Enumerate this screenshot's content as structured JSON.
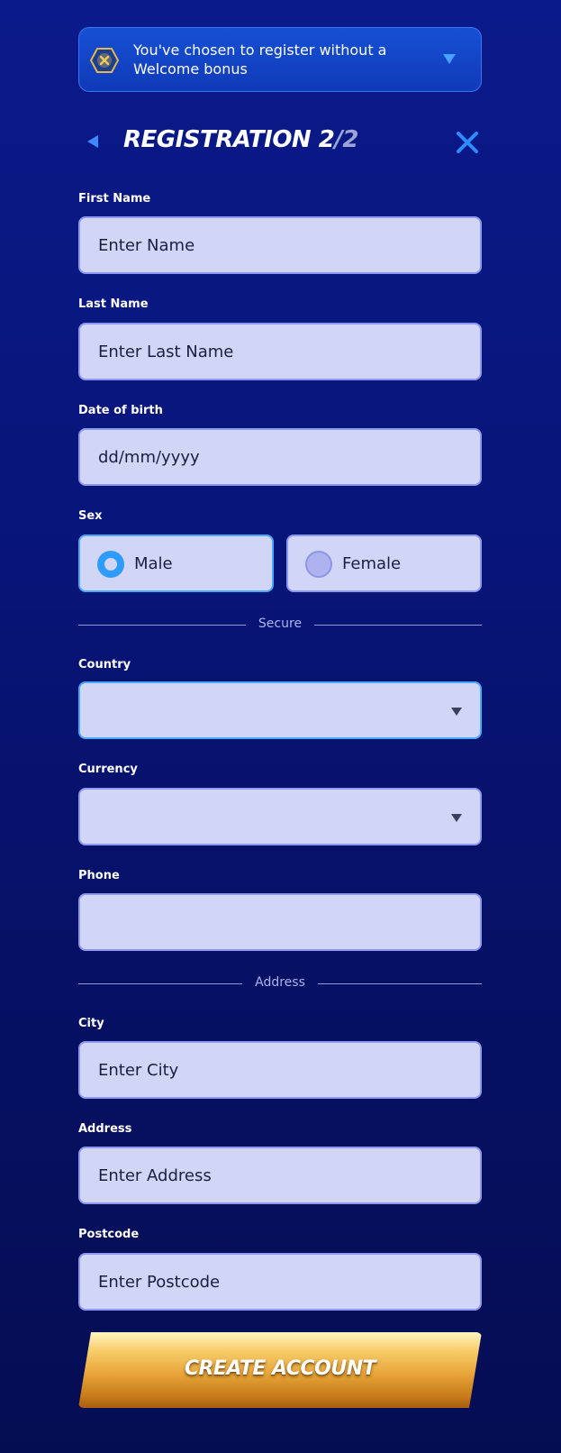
{
  "banner": {
    "text": "You've chosen to register without a Welcome bonus",
    "icon": "bonus-hexagon-icon"
  },
  "header": {
    "title": "REGISTRATION 2",
    "step_total": "/2"
  },
  "form": {
    "first_name": {
      "label": "First Name",
      "placeholder": "Enter Name"
    },
    "last_name": {
      "label": "Last Name",
      "placeholder": "Enter Last Name"
    },
    "dob": {
      "label": "Date of birth",
      "placeholder": "dd/mm/yyyy"
    },
    "sex": {
      "label": "Sex",
      "options": [
        "Male",
        "Female"
      ],
      "selected": "Male"
    },
    "divider_secure": "Secure",
    "country": {
      "label": "Country",
      "value": ""
    },
    "currency": {
      "label": "Currency",
      "value": ""
    },
    "phone": {
      "label": "Phone",
      "value": ""
    },
    "divider_address": "Address",
    "city": {
      "label": "City",
      "placeholder": "Enter City"
    },
    "address": {
      "label": "Address",
      "placeholder": "Enter Address"
    },
    "postcode": {
      "label": "Postcode",
      "placeholder": "Enter Postcode"
    }
  },
  "cta": {
    "label": "CREATE ACCOUNT"
  },
  "colors": {
    "background": "#08157a",
    "field_bg": "#d2d6f6",
    "field_border": "#8e98f0",
    "accent_blue": "#2e9cff",
    "cta_gold": "#e8a53a"
  }
}
